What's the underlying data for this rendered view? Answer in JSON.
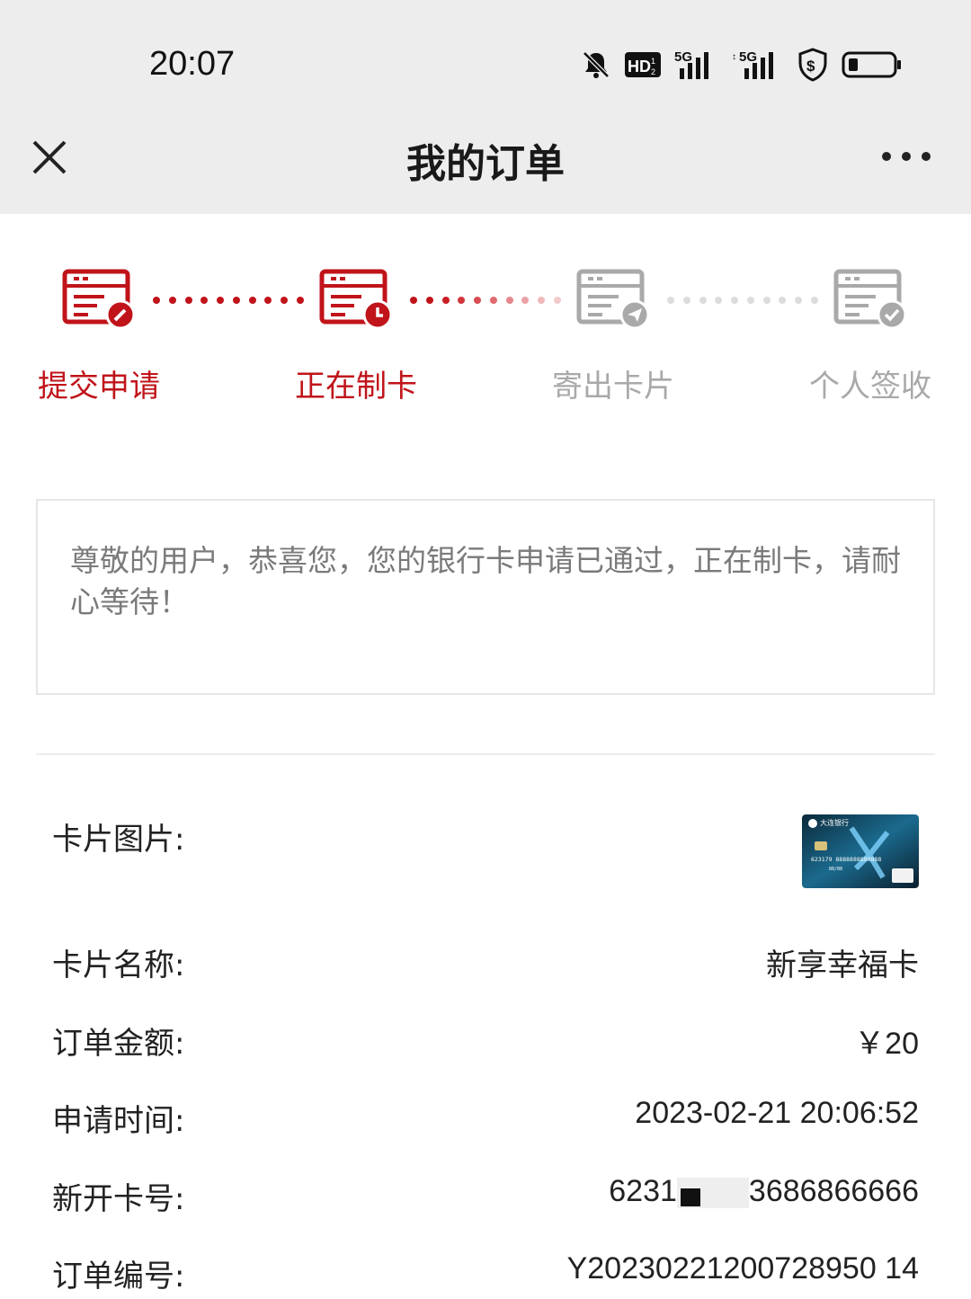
{
  "status_bar": {
    "time": "20:07",
    "icons": [
      "mute-bell-icon",
      "hd-icon",
      "signal-5g-icon",
      "signal-5g-icon",
      "shield-dollar-icon",
      "battery-icon"
    ]
  },
  "nav": {
    "title": "我的订单",
    "close_icon": "close-icon",
    "more_icon": "more-icon"
  },
  "progress": {
    "steps": [
      {
        "label": "提交申请",
        "state": "active",
        "icon": "form-edit-icon"
      },
      {
        "label": "正在制卡",
        "state": "active",
        "icon": "form-clock-icon"
      },
      {
        "label": "寄出卡片",
        "state": "inactive",
        "icon": "form-send-icon"
      },
      {
        "label": "个人签收",
        "state": "inactive",
        "icon": "form-check-icon"
      }
    ],
    "colors": {
      "active": "#c0141a",
      "inactive": "#a9a9a9"
    }
  },
  "message": {
    "text": "尊敬的用户，恭喜您，您的银行卡申请已通过，正在制卡，请耐心等待！"
  },
  "order": {
    "card_image_label": "卡片图片:",
    "card_name_label": "卡片名称:",
    "card_name": "新享幸福卡",
    "amount_label": "订单金额:",
    "amount": "￥20",
    "apply_time_label": "申请时间:",
    "apply_time": "2023-02-21 20:06:52",
    "card_no_label": "新开卡号:",
    "card_no_prefix": "6231",
    "card_no_suffix": "3686866666",
    "order_no_label": "订单编号:",
    "order_no": "Y20230221200728950 14"
  },
  "card_thumb": {
    "bank_name": "大连银行",
    "number": "623179 8888888888888",
    "expiry": "88/88"
  }
}
